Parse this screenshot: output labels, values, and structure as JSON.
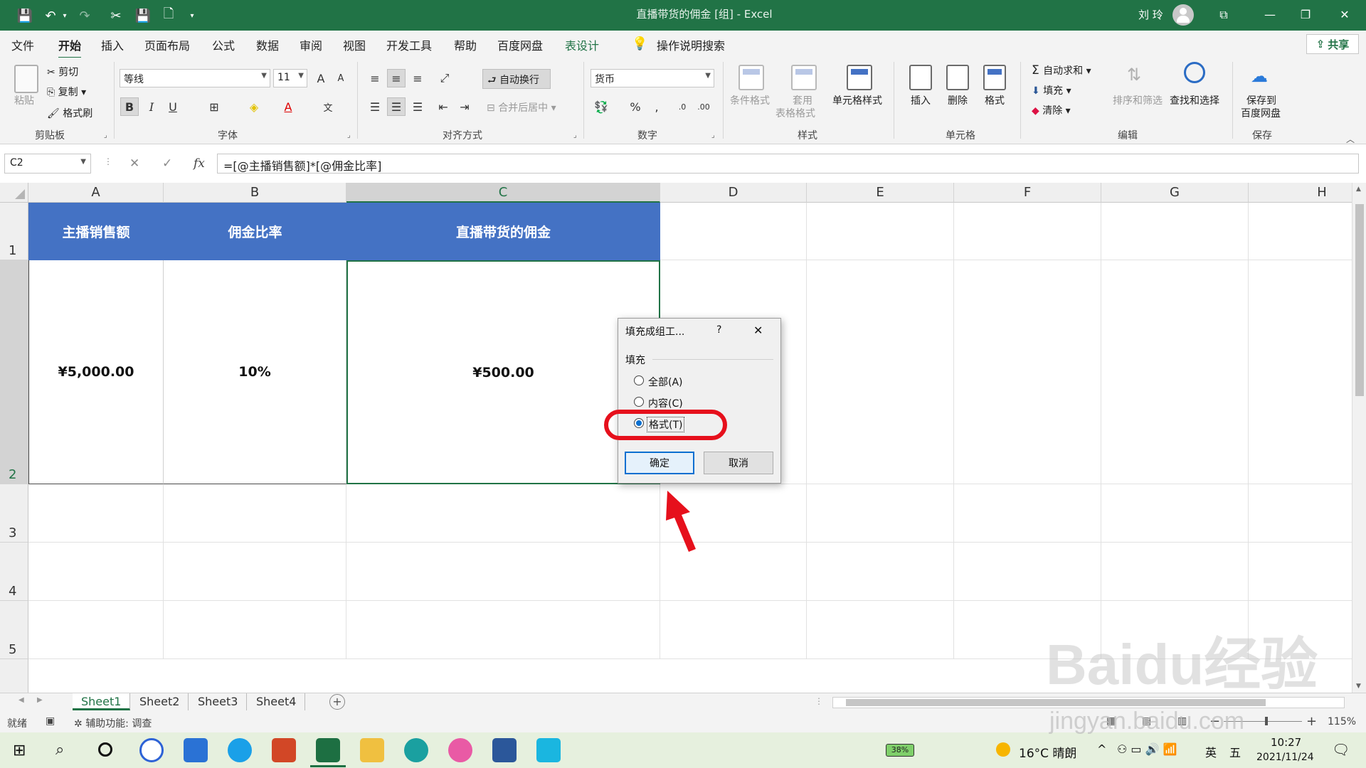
{
  "titlebar": {
    "title": "直播带货的佣金  [组]  -  Excel",
    "user": "刘 玲",
    "save_icon": "💾",
    "undo_icon": "↶",
    "redo_icon": "↷",
    "cut_icon": "✂",
    "newfile_icon": "🗋",
    "more_icon": "▾",
    "minimize": "—",
    "restore": "❐",
    "close": "✕",
    "ribbon_display": "⧉"
  },
  "menu": {
    "tabs": [
      "文件",
      "开始",
      "插入",
      "页面布局",
      "公式",
      "数据",
      "审阅",
      "视图",
      "开发工具",
      "帮助",
      "百度网盘",
      "表设计"
    ],
    "tell_me": "操作说明搜索",
    "share": "共享"
  },
  "ribbon": {
    "clipboard": {
      "paste": "粘贴",
      "cut": "剪切",
      "copy": "复制",
      "format_painter": "格式刷",
      "label": "剪贴板"
    },
    "font": {
      "name": "等线",
      "size": "11",
      "bold": "B",
      "italic": "I",
      "underline": "U",
      "label": "字体",
      "grow": "A",
      "shrink": "A",
      "wen": "文"
    },
    "alignment": {
      "wrap": "自动换行",
      "merge": "合并后居中",
      "label": "对齐方式"
    },
    "number": {
      "format": "货币",
      "percent": "%",
      "comma": ",",
      "label": "数字"
    },
    "styles": {
      "conditional": "条件格式",
      "table_format_1": "套用",
      "table_format_2": "表格格式",
      "cell_styles": "单元格样式",
      "label": "样式"
    },
    "cells": {
      "insert": "插入",
      "delete": "删除",
      "format": "格式",
      "label": "单元格"
    },
    "editing": {
      "autosum": "自动求和",
      "fill": "填充",
      "clear": "清除",
      "sort": "排序和筛选",
      "find": "查找和选择",
      "label": "编辑"
    },
    "save": {
      "line1": "保存到",
      "line2": "百度网盘",
      "label": "保存"
    }
  },
  "formula_bar": {
    "name_box": "C2",
    "formula": "=[@主播销售额]*[@佣金比率]",
    "cancel": "✕",
    "enter": "✓",
    "fx": "fx"
  },
  "grid": {
    "columns": [
      "A",
      "B",
      "C",
      "D",
      "E",
      "F",
      "G",
      "H"
    ],
    "rows": [
      "1",
      "2",
      "3",
      "4",
      "5"
    ],
    "header_row": [
      "主播销售额",
      "佣金比率",
      "直播带货的佣金"
    ],
    "data_row": [
      "¥5,000.00",
      "10%",
      "¥500.00"
    ]
  },
  "sheets": [
    "Sheet1",
    "Sheet2",
    "Sheet3",
    "Sheet4"
  ],
  "statusbar": {
    "mode": "就绪",
    "accessibility": "辅助功能: 调查",
    "zoom": "115%"
  },
  "dialog": {
    "title": "填充成组工...",
    "help": "?",
    "close": "✕",
    "group_label": "填充",
    "options": [
      "全部(A)",
      "内容(C)",
      "格式(T)"
    ],
    "selected": "格式(T)",
    "ok": "确定",
    "cancel": "取消"
  },
  "taskbar": {
    "battery": "38%",
    "weather": "16°C  晴朗",
    "ime_lang": "英",
    "ime_mode": "五",
    "time": "10:27",
    "date": "2021/11/24"
  },
  "watermark": {
    "brand": "Baidu经验",
    "site": "jingyan.baidu.com"
  },
  "colors": {
    "excel_green": "#217346",
    "table_header_blue": "#4472c4",
    "highlight_red": "#e6101c"
  }
}
